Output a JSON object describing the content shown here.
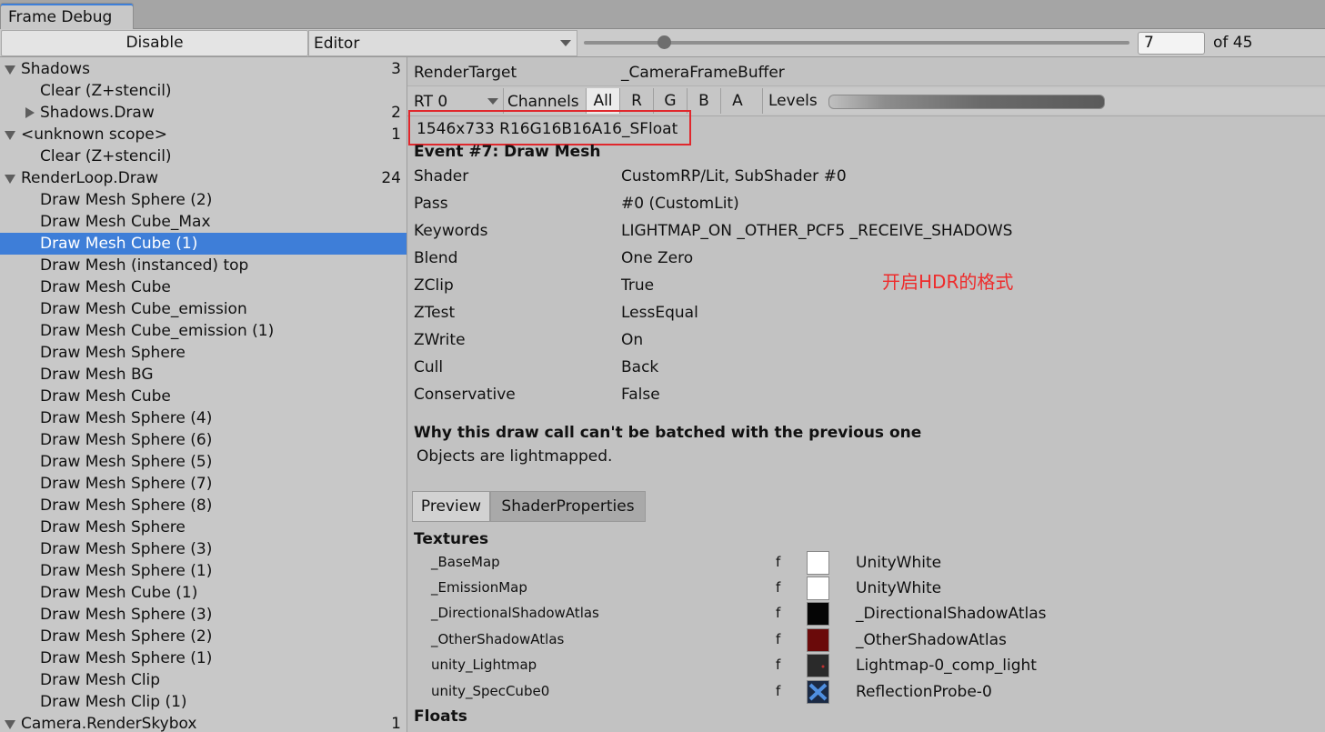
{
  "window": {
    "tab_title": "Frame Debug"
  },
  "toolbar": {
    "disable_label": "Disable",
    "target_value": "Editor",
    "event_index": "7",
    "event_total": "of 45",
    "slider_progress": 0.146
  },
  "tree": [
    {
      "label": "Shadows",
      "count": "3",
      "indent": 0,
      "expander": "open"
    },
    {
      "label": "Clear (Z+stencil)",
      "count": "",
      "indent": 1,
      "expander": "none"
    },
    {
      "label": "Shadows.Draw",
      "count": "2",
      "indent": 1,
      "expander": "closed"
    },
    {
      "label": "<unknown scope>",
      "count": "1",
      "indent": 0,
      "expander": "open"
    },
    {
      "label": "Clear (Z+stencil)",
      "count": "",
      "indent": 1,
      "expander": "none"
    },
    {
      "label": "RenderLoop.Draw",
      "count": "24",
      "indent": 0,
      "expander": "open"
    },
    {
      "label": "Draw Mesh Sphere (2)",
      "count": "",
      "indent": 1,
      "expander": "none"
    },
    {
      "label": "Draw Mesh Cube_Max",
      "count": "",
      "indent": 1,
      "expander": "none"
    },
    {
      "label": "Draw Mesh Cube (1)",
      "count": "",
      "indent": 1,
      "expander": "none",
      "selected": true
    },
    {
      "label": "Draw Mesh (instanced) top",
      "count": "",
      "indent": 1,
      "expander": "none"
    },
    {
      "label": "Draw Mesh Cube",
      "count": "",
      "indent": 1,
      "expander": "none"
    },
    {
      "label": "Draw Mesh Cube_emission",
      "count": "",
      "indent": 1,
      "expander": "none"
    },
    {
      "label": "Draw Mesh Cube_emission (1)",
      "count": "",
      "indent": 1,
      "expander": "none"
    },
    {
      "label": "Draw Mesh Sphere",
      "count": "",
      "indent": 1,
      "expander": "none"
    },
    {
      "label": "Draw Mesh BG",
      "count": "",
      "indent": 1,
      "expander": "none"
    },
    {
      "label": "Draw Mesh Cube",
      "count": "",
      "indent": 1,
      "expander": "none"
    },
    {
      "label": "Draw Mesh Sphere (4)",
      "count": "",
      "indent": 1,
      "expander": "none"
    },
    {
      "label": "Draw Mesh Sphere (6)",
      "count": "",
      "indent": 1,
      "expander": "none"
    },
    {
      "label": "Draw Mesh Sphere (5)",
      "count": "",
      "indent": 1,
      "expander": "none"
    },
    {
      "label": "Draw Mesh Sphere (7)",
      "count": "",
      "indent": 1,
      "expander": "none"
    },
    {
      "label": "Draw Mesh Sphere (8)",
      "count": "",
      "indent": 1,
      "expander": "none"
    },
    {
      "label": "Draw Mesh Sphere",
      "count": "",
      "indent": 1,
      "expander": "none"
    },
    {
      "label": "Draw Mesh Sphere (3)",
      "count": "",
      "indent": 1,
      "expander": "none"
    },
    {
      "label": "Draw Mesh Sphere (1)",
      "count": "",
      "indent": 1,
      "expander": "none"
    },
    {
      "label": "Draw Mesh Cube (1)",
      "count": "",
      "indent": 1,
      "expander": "none"
    },
    {
      "label": "Draw Mesh Sphere (3)",
      "count": "",
      "indent": 1,
      "expander": "none"
    },
    {
      "label": "Draw Mesh Sphere (2)",
      "count": "",
      "indent": 1,
      "expander": "none"
    },
    {
      "label": "Draw Mesh Sphere (1)",
      "count": "",
      "indent": 1,
      "expander": "none"
    },
    {
      "label": "Draw Mesh Clip",
      "count": "",
      "indent": 1,
      "expander": "none"
    },
    {
      "label": "Draw Mesh Clip (1)",
      "count": "",
      "indent": 1,
      "expander": "none"
    },
    {
      "label": "Camera.RenderSkybox",
      "count": "1",
      "indent": 0,
      "expander": "open"
    }
  ],
  "details": {
    "render_target_label": "RenderTarget",
    "render_target_value": "_CameraFrameBuffer",
    "rt_select": "RT 0",
    "channels_label": "Channels",
    "channels": [
      "All",
      "R",
      "G",
      "B",
      "A"
    ],
    "channels_active": "All",
    "levels_label": "Levels",
    "format": "1546x733 R16G16B16A16_SFloat",
    "event_title": "Event #7: Draw Mesh",
    "props": [
      {
        "key": "Shader",
        "value": "CustomRP/Lit, SubShader #0"
      },
      {
        "key": "Pass",
        "value": "#0 (CustomLit)"
      },
      {
        "key": "Keywords",
        "value": "LIGHTMAP_ON _OTHER_PCF5 _RECEIVE_SHADOWS"
      },
      {
        "key": "Blend",
        "value": "One Zero"
      },
      {
        "key": "ZClip",
        "value": "True"
      },
      {
        "key": "ZTest",
        "value": "LessEqual"
      },
      {
        "key": "ZWrite",
        "value": "On"
      },
      {
        "key": "Cull",
        "value": "Back"
      },
      {
        "key": "Conservative",
        "value": "False"
      }
    ],
    "batch_heading": "Why this draw call can't be batched with the previous one",
    "batch_reason": "Objects are lightmapped.",
    "annotation": "开启HDR的格式",
    "tab_preview": "Preview",
    "tab_shader_props": "ShaderProperties",
    "textures_heading": "Textures",
    "textures": [
      {
        "name": "_BaseMap",
        "stage": "f",
        "value": "UnityWhite",
        "swatch": "#ffffff",
        "icon": "white-texture-icon"
      },
      {
        "name": "_EmissionMap",
        "stage": "f",
        "value": "UnityWhite",
        "swatch": "#ffffff",
        "icon": "white-texture-icon"
      },
      {
        "name": "_DirectionalShadowAtlas",
        "stage": "f",
        "value": "_DirectionalShadowAtlas",
        "swatch": "#050505",
        "icon": "black-texture-icon"
      },
      {
        "name": "_OtherShadowAtlas",
        "stage": "f",
        "value": "_OtherShadowAtlas",
        "swatch": "#6a0a0a",
        "icon": "red-texture-icon"
      },
      {
        "name": "unity_Lightmap",
        "stage": "f",
        "value": "Lightmap-0_comp_light",
        "swatch": "#2a2a2a",
        "icon": "lightmap-texture-icon"
      },
      {
        "name": "unity_SpecCube0",
        "stage": "f",
        "value": "ReflectionProbe-0",
        "swatch": "#1b2a44",
        "icon": "reflection-probe-icon"
      }
    ],
    "floats_heading": "Floats"
  },
  "colors": {
    "selection": "#3e7ed8",
    "annotation": "#ee2b2b",
    "highlight_box": "#e0272c"
  }
}
